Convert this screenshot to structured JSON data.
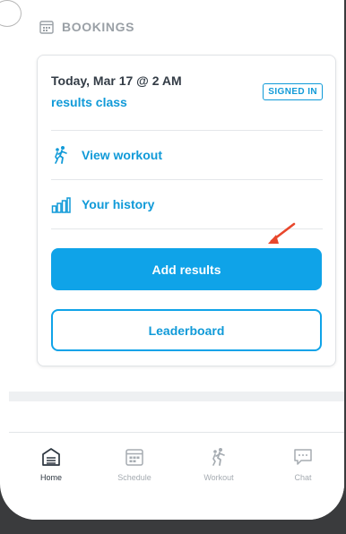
{
  "bookings": {
    "title": "BOOKINGS",
    "card": {
      "date": "Today, Mar 17 @ 2 AM",
      "class_name": "results class",
      "badge": "SIGNED IN",
      "links": [
        {
          "label": "View workout",
          "icon": "workout-figure-icon"
        },
        {
          "label": "Your history",
          "icon": "bar-chart-icon"
        }
      ],
      "primary_button": "Add results",
      "secondary_button": "Leaderboard"
    }
  },
  "tabbar": {
    "items": [
      {
        "label": "Home",
        "icon": "home-icon",
        "active": true
      },
      {
        "label": "Schedule",
        "icon": "calendar-icon",
        "active": false
      },
      {
        "label": "Workout",
        "icon": "workout-figure-icon",
        "active": false
      },
      {
        "label": "Chat",
        "icon": "chat-icon",
        "active": false
      }
    ]
  },
  "colors": {
    "accent": "#0fa3e8",
    "muted": "#9aa0a6",
    "text": "#333c46",
    "annotation_arrow": "#e8472c"
  }
}
